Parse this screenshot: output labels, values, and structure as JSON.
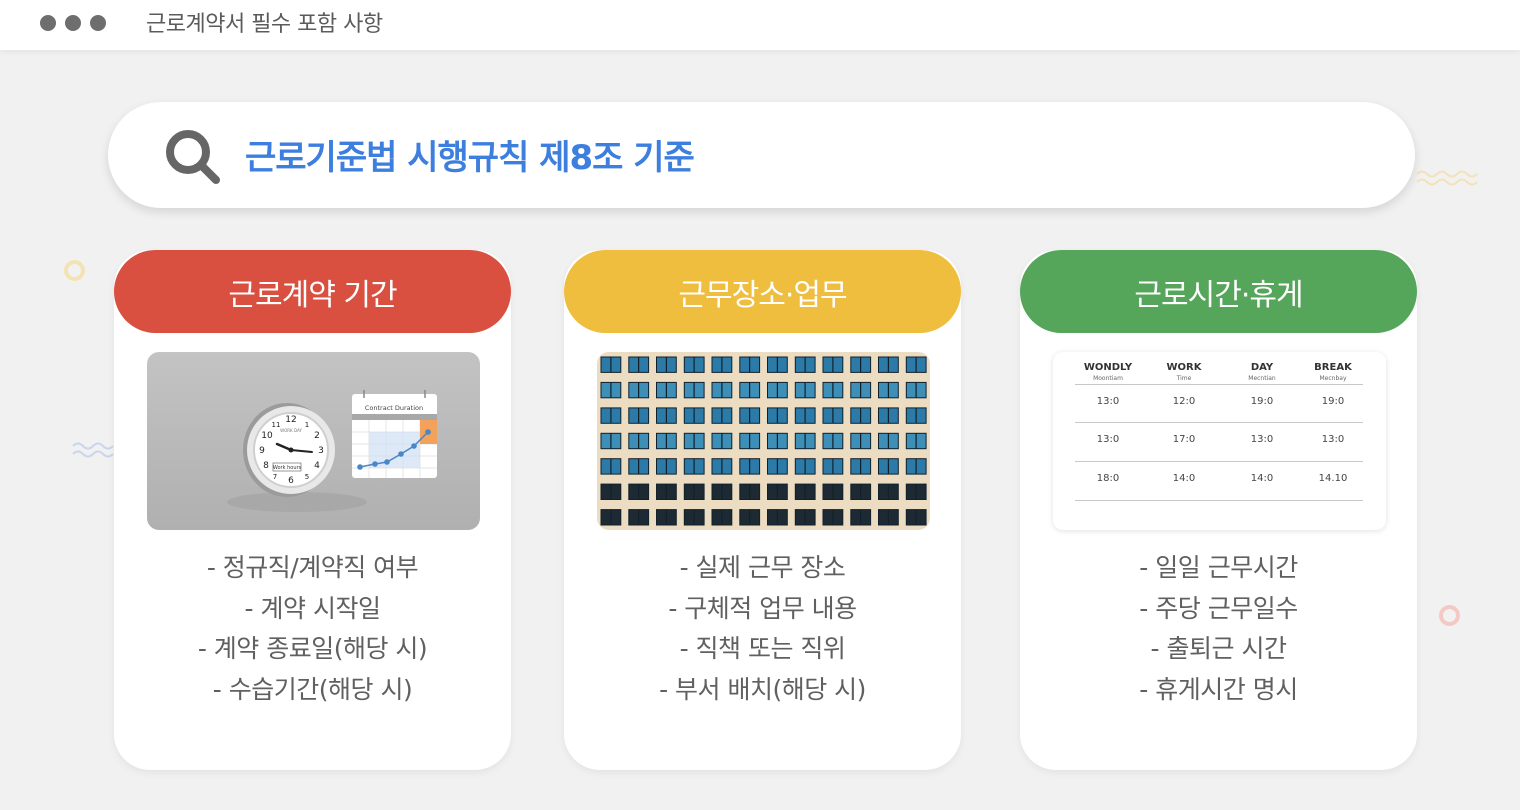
{
  "header": {
    "title": "근로계약서 필수 포함 사항"
  },
  "search": {
    "text": "근로기준법 시행규칙 제8조 기준"
  },
  "colors": {
    "accent_blue": "#3d7fde",
    "card1": "#d94f40",
    "card2": "#efbe3f",
    "card3": "#55a65b"
  },
  "cards": [
    {
      "title": "근로계약 기간",
      "image_icon": "clock-calendar-icon",
      "image_text": {
        "calendar_title": "Contract Duration",
        "clock_label": "WORK DAY",
        "clock_tag": "Work hours",
        "clock_numbers": [
          "12",
          "1",
          "2",
          "3",
          "4",
          "5",
          "6",
          "7",
          "8",
          "9",
          "10",
          "11"
        ]
      },
      "items": [
        "- 정규직/계약직 여부",
        "- 계약 시작일",
        "- 계약 종료일(해당 시)",
        "- 수습기간(해당 시)"
      ]
    },
    {
      "title": "근무장소·업무",
      "image_icon": "office-building-icon",
      "items": [
        "- 실제 근무 장소",
        "- 구체적 업무 내용",
        "- 직책 또는 직위",
        "- 부서 배치(해당 시)"
      ]
    },
    {
      "title": "근로시간·휴게",
      "image_icon": "schedule-table-icon",
      "schedule": {
        "columns": [
          {
            "h1": "WONDLY",
            "h2": "Moontiam"
          },
          {
            "h1": "WORK",
            "h2": "Time"
          },
          {
            "h1": "DAY",
            "h2": "Mecntian"
          },
          {
            "h1": "BREAK",
            "h2": "Mecnbay"
          }
        ],
        "rows": [
          [
            "13:0",
            "12:0",
            "19:0",
            "19:0"
          ],
          [
            "13:0",
            "17:0",
            "13:0",
            "13:0"
          ],
          [
            "18:0",
            "14:0",
            "14:0",
            "14.10"
          ]
        ]
      },
      "items": [
        "- 일일 근무시간",
        "- 주당 근무일수",
        "- 출퇴근 시간",
        "- 휴게시간 명시"
      ]
    }
  ]
}
